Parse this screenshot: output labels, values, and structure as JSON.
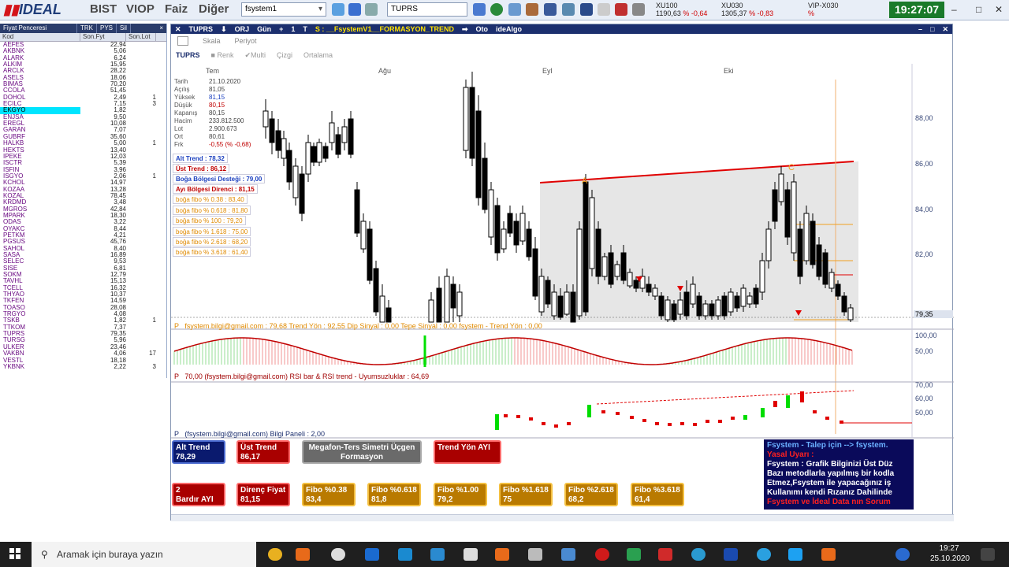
{
  "topbar": {
    "logo": "IDEAL",
    "menus": [
      "BIST",
      "VIOP",
      "Faiz",
      "Diğer"
    ],
    "system_combo": "fsystem1",
    "symbol_input": "TUPRS",
    "indices": [
      {
        "name": "XU100",
        "value": "1190,63",
        "pct": "% -0,64"
      },
      {
        "name": "XU030",
        "value": "1305,37",
        "pct": "% -0,83"
      },
      {
        "name": "VIP-X030",
        "value": "",
        "pct": "%"
      }
    ],
    "clock": "19:27:07",
    "window_controls": [
      "–",
      "□",
      "✕"
    ]
  },
  "left_panel": {
    "tabs": [
      "Fiyat Penceresi",
      "TRK",
      "PYS",
      "Sil",
      "×"
    ],
    "headers": [
      "Kod",
      "Son.Fyt",
      "Son.Lot"
    ],
    "rows": [
      {
        "kod": "AEFES",
        "fyt": "22,94",
        "lot": ""
      },
      {
        "kod": "AKBNK",
        "fyt": "5,06",
        "lot": ""
      },
      {
        "kod": "ALARK",
        "fyt": "6,24",
        "lot": ""
      },
      {
        "kod": "ALKIM",
        "fyt": "15,95",
        "lot": ""
      },
      {
        "kod": "ARCLK",
        "fyt": "28,22",
        "lot": ""
      },
      {
        "kod": "ASELS",
        "fyt": "18,06",
        "lot": ""
      },
      {
        "kod": "BIMAS",
        "fyt": "70,20",
        "lot": ""
      },
      {
        "kod": "CCOLA",
        "fyt": "51,45",
        "lot": ""
      },
      {
        "kod": "DOHOL",
        "fyt": "2,49",
        "lot": "1"
      },
      {
        "kod": "ECILC",
        "fyt": "7,15",
        "lot": "3"
      },
      {
        "kod": "EKGYO",
        "fyt": "1,82",
        "lot": ""
      },
      {
        "kod": "ENJSA",
        "fyt": "9,50",
        "lot": ""
      },
      {
        "kod": "EREGL",
        "fyt": "10,08",
        "lot": ""
      },
      {
        "kod": "GARAN",
        "fyt": "7,07",
        "lot": ""
      },
      {
        "kod": "GUBRF",
        "fyt": "35,60",
        "lot": ""
      },
      {
        "kod": "HALKB",
        "fyt": "5,00",
        "lot": "1"
      },
      {
        "kod": "HEKTS",
        "fyt": "13,40",
        "lot": ""
      },
      {
        "kod": "IPEKE",
        "fyt": "12,03",
        "lot": ""
      },
      {
        "kod": "ISCTR",
        "fyt": "5,39",
        "lot": ""
      },
      {
        "kod": "ISFIN",
        "fyt": "3,96",
        "lot": ""
      },
      {
        "kod": "ISGYO",
        "fyt": "2,06",
        "lot": "1"
      },
      {
        "kod": "KCHOL",
        "fyt": "14,97",
        "lot": ""
      },
      {
        "kod": "KOZAA",
        "fyt": "13,28",
        "lot": ""
      },
      {
        "kod": "KOZAL",
        "fyt": "78,45",
        "lot": ""
      },
      {
        "kod": "KRDMD",
        "fyt": "3,48",
        "lot": ""
      },
      {
        "kod": "MGROS",
        "fyt": "42,84",
        "lot": ""
      },
      {
        "kod": "MPARK",
        "fyt": "18,30",
        "lot": ""
      },
      {
        "kod": "ODAS",
        "fyt": "3,22",
        "lot": ""
      },
      {
        "kod": "OYAKC",
        "fyt": "8,44",
        "lot": ""
      },
      {
        "kod": "PETKM",
        "fyt": "4,21",
        "lot": ""
      },
      {
        "kod": "PGSUS",
        "fyt": "45,76",
        "lot": ""
      },
      {
        "kod": "SAHOL",
        "fyt": "8,40",
        "lot": ""
      },
      {
        "kod": "SASA",
        "fyt": "16,89",
        "lot": ""
      },
      {
        "kod": "SELEC",
        "fyt": "9,53",
        "lot": ""
      },
      {
        "kod": "SISE",
        "fyt": "6,81",
        "lot": ""
      },
      {
        "kod": "SOKM",
        "fyt": "12,79",
        "lot": ""
      },
      {
        "kod": "TAVHL",
        "fyt": "15,13",
        "lot": ""
      },
      {
        "kod": "TCELL",
        "fyt": "16,32",
        "lot": ""
      },
      {
        "kod": "THYAO",
        "fyt": "10,37",
        "lot": ""
      },
      {
        "kod": "TKFEN",
        "fyt": "14,59",
        "lot": ""
      },
      {
        "kod": "TOASO",
        "fyt": "28,08",
        "lot": ""
      },
      {
        "kod": "TRGYO",
        "fyt": "4,08",
        "lot": ""
      },
      {
        "kod": "TSKB",
        "fyt": "1,82",
        "lot": "1"
      },
      {
        "kod": "TTKOM",
        "fyt": "7,37",
        "lot": ""
      },
      {
        "kod": "TUPRS",
        "fyt": "79,35",
        "lot": ""
      },
      {
        "kod": "TURSG",
        "fyt": "5,96",
        "lot": ""
      },
      {
        "kod": "ULKER",
        "fyt": "23,46",
        "lot": ""
      },
      {
        "kod": "VAKBN",
        "fyt": "4,06",
        "lot": "17"
      },
      {
        "kod": "VESTL",
        "fyt": "18,18",
        "lot": ""
      },
      {
        "kod": "YKBNK",
        "fyt": "2,22",
        "lot": "3"
      }
    ],
    "selected": "EKGYO"
  },
  "chart_window": {
    "title_items": [
      "TUPRS",
      "ORJ",
      "Gün",
      "+",
      "1",
      "T",
      "S : __FsystemV1__FORMASYON_TREND",
      "Oto",
      "ideAlgo"
    ],
    "toolbar1": [
      "Skala",
      "Periyot"
    ],
    "toolbar2": {
      "symbol": "TUPRS",
      "items": [
        "Renk",
        "Multi",
        "Çizgi",
        "Ortalama"
      ]
    },
    "months": [
      "Tem",
      "Ağu",
      "Eyl",
      "Eki"
    ],
    "info": [
      {
        "k": "Tarih",
        "v": "21.10.2020"
      },
      {
        "k": "Açılış",
        "v": "81,05"
      },
      {
        "k": "Yüksek",
        "v": "81,15"
      },
      {
        "k": "Düşük",
        "v": "80,15"
      },
      {
        "k": "Kapanış",
        "v": "80,15"
      },
      {
        "k": "Hacim",
        "v": "233.812.500"
      },
      {
        "k": "Lot",
        "v": "2.900.673"
      },
      {
        "k": "Ort",
        "v": "80,61"
      },
      {
        "k": "Frk",
        "v": "-0,55 (% -0,68)"
      }
    ],
    "trend_labels": [
      "Alt Trend : 78,32",
      "Üst Trend : 86,12",
      "Boğa Bölgesi Desteği : 79,00",
      "Ayı Bölgesi Direnci : 81,15",
      "boğa fibo % 0.38 : 83,40",
      "boğa fibo % 0.618 : 81,80",
      "boğa fibo % 100 : 79,20",
      "boğa fibo % 1.618 : 75,00",
      "boğa fibo % 2.618 : 68,20",
      "boğa fibo % 3.618 : 61,40"
    ],
    "price_axis": [
      "88,00",
      "86,00",
      "84,00",
      "82,00",
      "79,35"
    ],
    "last_price": "79,35",
    "panel2_label": "fsystem.bilgi@gmail.com : 79,68   Trend Yön : 92,55   Dip Sinyal : 0,00   Tepe Sinyal : 0,00   fsystem - Trend Yön : 0,00",
    "panel2_axis": [
      "100,00",
      "50,00"
    ],
    "panel3_label": "70,00   (fsystem.bilgi@gmail.com) RSI bar & RSI trend - Uyumsuzluklar : 64,69",
    "panel3_axis": [
      "70,00",
      "60,00",
      "50,00"
    ],
    "panel4_label": "(fsystem.bilgi@gmail.com) Bilgi Paneli : 2,00",
    "badges_row1": [
      {
        "l1": "Alt Trend",
        "l2": "78,29",
        "style": "blue"
      },
      {
        "l1": "Üst Trend",
        "l2": "86,17",
        "style": "red"
      },
      {
        "l1": "Megafon-Ters Simetri Üçgen",
        "l2": "Formasyon",
        "style": "gray"
      },
      {
        "l1": "Trend Yön AYI",
        "l2": "",
        "style": "red"
      }
    ],
    "badges_row2": [
      {
        "l1": "2",
        "l2": "Bardır AYI",
        "style": "red"
      },
      {
        "l1": "Direnç Fiyat",
        "l2": "81,15",
        "style": "red"
      },
      {
        "l1": "Fibo %0.38",
        "l2": "83,4",
        "style": "gold"
      },
      {
        "l1": "Fibo %0.618",
        "l2": "81,8",
        "style": "gold"
      },
      {
        "l1": "Fibo %1.00",
        "l2": "79,2",
        "style": "gold"
      },
      {
        "l1": "Fibo %1.618",
        "l2": "75",
        "style": "gold"
      },
      {
        "l1": "Fibo %2.618",
        "l2": "68,2",
        "style": "gold"
      },
      {
        "l1": "Fibo %3.618",
        "l2": "61,4",
        "style": "gold"
      }
    ],
    "notice": [
      "Fsystem - Talep için --> fsystem.",
      "Yasal Uyarı :",
      "Fsystem : Grafik Bilginizi Üst Düz",
      "Bazı metodlarla yapılmış bir kodla",
      "Etmez,Fsystem ile yapacağınız iş",
      "Kullanımı kendi Rızanız Dahilinde",
      "Fsystem ve İdeal Data nın Sorum"
    ]
  },
  "taskbar": {
    "search_placeholder": "Aramak için buraya yazın",
    "time": "19:27",
    "date": "25.10.2020"
  },
  "colors": {
    "header_blue": "#1c2f6e",
    "clock_green": "#1a7a2a",
    "trend_red": "#e00000",
    "fibo_orange": "#f0a020",
    "rsi_green": "#00dd00",
    "rsi_red": "#ff0000"
  }
}
